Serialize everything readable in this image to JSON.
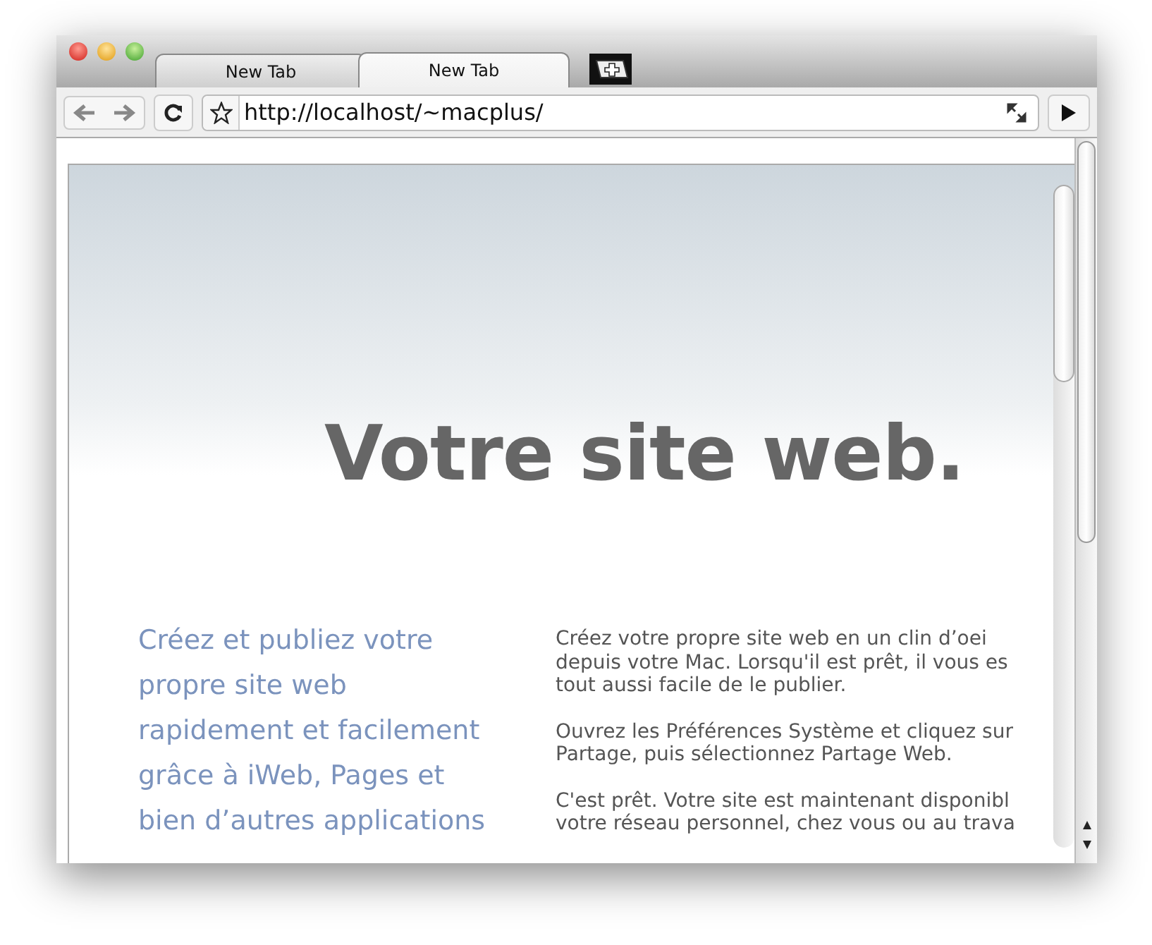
{
  "tabs": [
    {
      "label": "New Tab",
      "selected": false
    },
    {
      "label": "New Tab",
      "selected": true
    }
  ],
  "address_bar": {
    "value": "http://localhost/~macplus/"
  },
  "page": {
    "heading": "Votre site web.",
    "intro_lines": [
      "Créez et publiez votre",
      "propre site web",
      "rapidement et facilement",
      "grâce à iWeb, Pages et",
      "bien d’autres applications"
    ],
    "paragraphs": [
      [
        "Créez votre propre site web en un clin d’oei",
        "depuis votre Mac. Lorsqu'il est prêt, il vous es",
        "tout aussi facile de le publier."
      ],
      [
        "Ouvrez les Préférences Système et cliquez sur",
        "Partage, puis sélectionnez Partage Web."
      ],
      [
        "C'est prêt. Votre site est maintenant disponibl",
        "votre réseau personnel, chez vous ou au trava"
      ]
    ]
  }
}
